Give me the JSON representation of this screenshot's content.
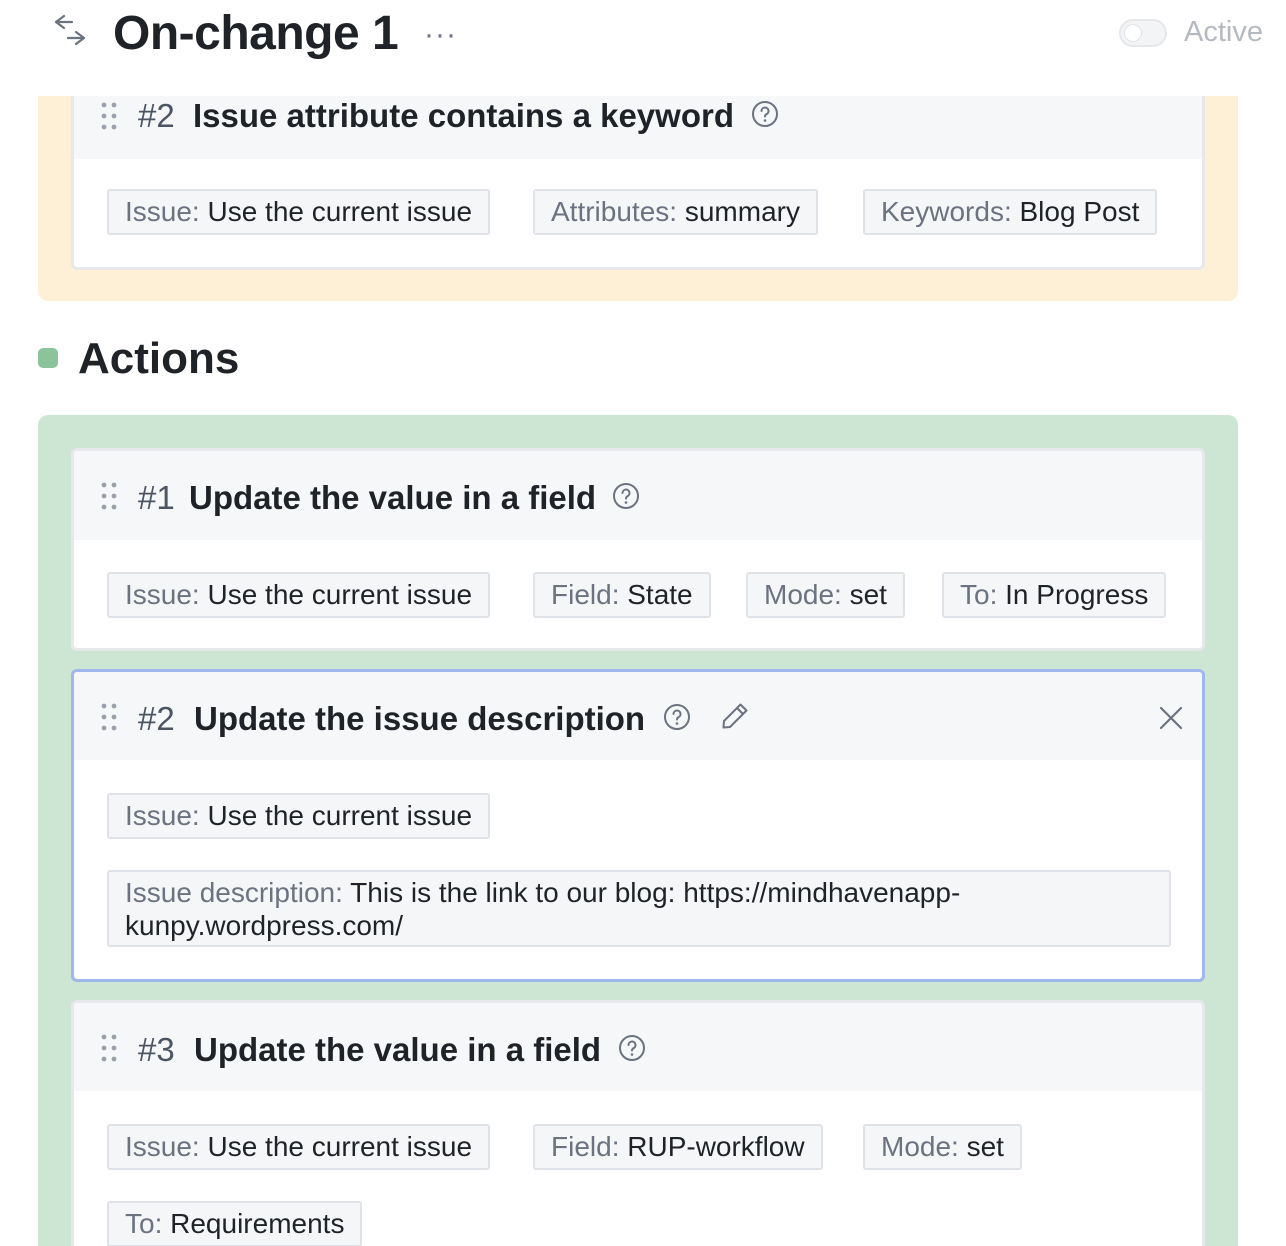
{
  "header": {
    "title": "On-change 1",
    "more": "···",
    "active_label": "Active",
    "active": false
  },
  "conditions": {
    "card2": {
      "number": "#2",
      "title": "Issue attribute contains a keyword",
      "chips": [
        {
          "key": "Issue:",
          "value": "Use the current issue"
        },
        {
          "key": "Attributes:",
          "value": "summary"
        },
        {
          "key": "Keywords:",
          "value": "Blog Post"
        }
      ]
    }
  },
  "actions": {
    "heading": "Actions",
    "items": [
      {
        "number": "#1",
        "title": "Update the value in a field",
        "chips": [
          {
            "key": "Issue:",
            "value": "Use the current issue"
          },
          {
            "key": "Field:",
            "value": "State"
          },
          {
            "key": "Mode:",
            "value": "set"
          },
          {
            "key": "To:",
            "value": "In Progress"
          }
        ]
      },
      {
        "number": "#2",
        "title": "Update the issue description",
        "chips": [
          {
            "key": "Issue:",
            "value": "Use the current issue"
          },
          {
            "key": "Issue description:",
            "value": "This is the link to our blog: https://mindhavenapp-kunpy.wordpress.com/"
          }
        ]
      },
      {
        "number": "#3",
        "title": "Update the value in a field",
        "chips": [
          {
            "key": "Issue:",
            "value": "Use the current issue"
          },
          {
            "key": "Field:",
            "value": "RUP-workflow"
          },
          {
            "key": "Mode:",
            "value": "set"
          },
          {
            "key": "To:",
            "value": "Requirements"
          }
        ]
      }
    ]
  },
  "colors": {
    "conditions_bg": "#fdf0d6",
    "actions_bg": "#cde6d4",
    "actions_dot": "#8bc39a",
    "selected_border": "#9fb6ee"
  }
}
